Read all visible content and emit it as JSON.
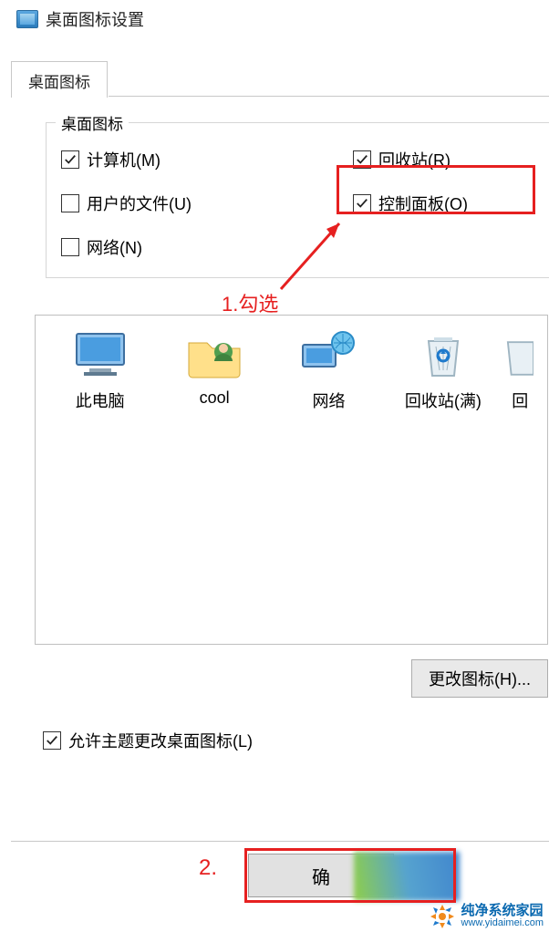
{
  "window": {
    "title": "桌面图标设置"
  },
  "tab": {
    "label": "桌面图标"
  },
  "group": {
    "legend": "桌面图标",
    "checks": {
      "computer": {
        "label": "计算机(M)",
        "checked": true
      },
      "recycle": {
        "label": "回收站(R)",
        "checked": true
      },
      "userfiles": {
        "label": "用户的文件(U)",
        "checked": false
      },
      "control": {
        "label": "控制面板(O)",
        "checked": true
      },
      "network": {
        "label": "网络(N)",
        "checked": false
      }
    }
  },
  "annotations": {
    "step1": "1.勾选",
    "step2": "2."
  },
  "icons": {
    "thispc": {
      "label": "此电脑"
    },
    "user": {
      "label": "cool"
    },
    "network": {
      "label": "网络"
    },
    "recyclefull": {
      "label": "回收站(满)"
    },
    "cutoff": {
      "label": "回"
    }
  },
  "buttons": {
    "change_icon": "更改图标(H)...",
    "ok": "确"
  },
  "allow_theme": {
    "label": "允许主题更改桌面图标(L)",
    "checked": true
  },
  "watermark": {
    "title": "纯净系统家园",
    "url": "www.yidaimei.com"
  }
}
